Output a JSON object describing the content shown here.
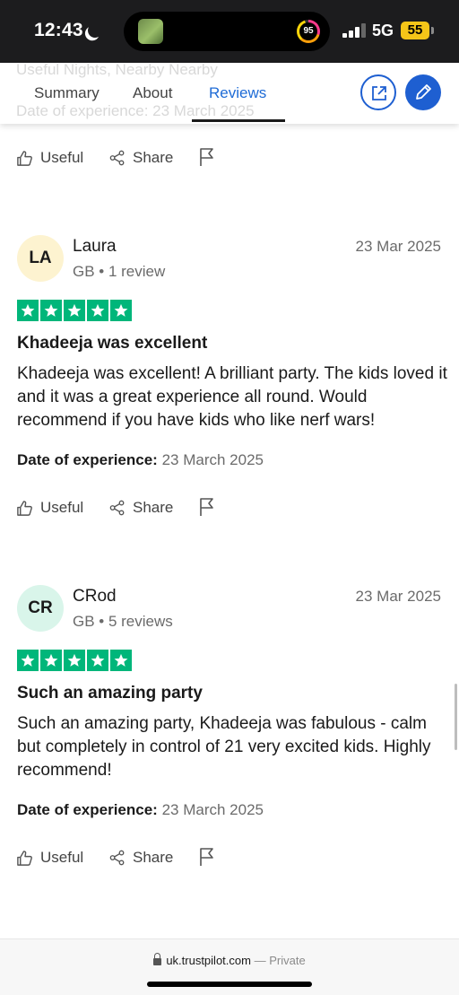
{
  "status_bar": {
    "time": "12:43",
    "activity_ring_value": "95",
    "network": "5G",
    "battery": "55"
  },
  "header": {
    "ghost_lines": [
      "Useful Nights, Nearby Nearby",
      "Date of experience: 23 March 2025"
    ],
    "tabs": [
      {
        "label": "Summary"
      },
      {
        "label": "About"
      },
      {
        "label": "Reviews"
      }
    ],
    "active_tab": "Reviews",
    "accent_color": "#1e5fd1"
  },
  "actions": {
    "useful_label": "Useful",
    "share_label": "Share"
  },
  "reviews": [
    {
      "initials": "LA",
      "avatar_color": "#fdf3d0",
      "name": "Laura",
      "country": "GB",
      "review_count": "1 review",
      "date": "23 Mar 2025",
      "stars": 5,
      "title": "Khadeeja was excellent",
      "body": "Khadeeja was excellent! A brilliant party. The kids loved it and it was a great experience all round. Would recommend if you have kids who like nerf wars!",
      "experience_label": "Date of experience:",
      "experience_date": "23 March 2025"
    },
    {
      "initials": "CR",
      "avatar_color": "#d9f5ea",
      "name": "CRod",
      "country": "GB",
      "review_count": "5 reviews",
      "date": "23 Mar 2025",
      "stars": 5,
      "title": "Such an amazing party",
      "body": "Such an amazing party, Khadeeja was fabulous - calm but completely in control of 21 very excited kids. Highly recommend!",
      "experience_label": "Date of experience:",
      "experience_date": "23 March 2025"
    }
  ],
  "star_color": "#00b67a",
  "browser": {
    "url": "uk.trustpilot.com",
    "separator": "—",
    "mode": "Private"
  }
}
